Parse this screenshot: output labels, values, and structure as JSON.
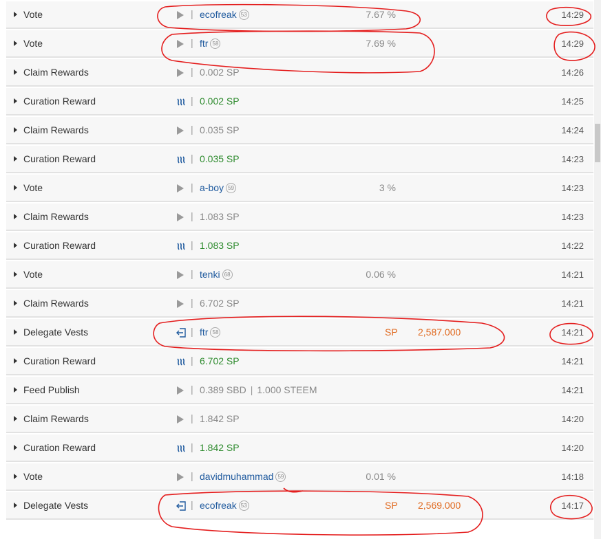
{
  "colors": {
    "user_link": "#1f5a9e",
    "sp_green": "#2e8b2e",
    "sp_orange": "#e0691f",
    "annotation_red": "#e41e1e"
  },
  "rows": [
    {
      "op": "Vote",
      "icon": "play-icon",
      "user": "ecofreak",
      "rep": "53",
      "percent": "7.67 %",
      "time": "14:29"
    },
    {
      "op": "Vote",
      "icon": "play-icon",
      "user": "ftr",
      "rep": "58",
      "percent": "7.69 %",
      "time": "14:29"
    },
    {
      "op": "Claim Rewards",
      "icon": "play-icon",
      "amount": "0.002 SP",
      "time": "14:26"
    },
    {
      "op": "Curation Reward",
      "icon": "steem-icon",
      "amount": "0.002 SP",
      "time": "14:25"
    },
    {
      "op": "Claim Rewards",
      "icon": "play-icon",
      "amount": "0.035 SP",
      "time": "14:24"
    },
    {
      "op": "Curation Reward",
      "icon": "steem-icon",
      "amount": "0.035 SP",
      "time": "14:23"
    },
    {
      "op": "Vote",
      "icon": "play-icon",
      "user": "a-boy",
      "rep": "59",
      "percent": "3 %",
      "time": "14:23"
    },
    {
      "op": "Claim Rewards",
      "icon": "play-icon",
      "amount": "1.083 SP",
      "time": "14:23"
    },
    {
      "op": "Curation Reward",
      "icon": "steem-icon",
      "amount": "1.083 SP",
      "time": "14:22"
    },
    {
      "op": "Vote",
      "icon": "play-icon",
      "user": "tenki",
      "rep": "68",
      "percent": "0.06 %",
      "time": "14:21"
    },
    {
      "op": "Claim Rewards",
      "icon": "play-icon",
      "amount": "6.702 SP",
      "time": "14:21"
    },
    {
      "op": "Delegate Vests",
      "icon": "delegate-icon",
      "user": "ftr",
      "rep": "58",
      "sp_label": "SP",
      "sp_amount": "2,587.000",
      "time": "14:21"
    },
    {
      "op": "Curation Reward",
      "icon": "steem-icon",
      "amount": "6.702 SP",
      "time": "14:21"
    },
    {
      "op": "Feed Publish",
      "icon": "play-icon",
      "sbd": "0.389 SBD",
      "steem": "1.000 STEEM",
      "time": "14:21"
    },
    {
      "op": "Claim Rewards",
      "icon": "play-icon",
      "amount": "1.842 SP",
      "time": "14:20"
    },
    {
      "op": "Curation Reward",
      "icon": "steem-icon",
      "amount": "1.842 SP",
      "time": "14:20"
    },
    {
      "op": "Vote",
      "icon": "play-icon",
      "user": "davidmuhammad",
      "rep": "59",
      "percent": "0.01 %",
      "time": "14:18"
    },
    {
      "op": "Delegate Vests",
      "icon": "delegate-icon",
      "user": "ecofreak",
      "rep": "53",
      "sp_label": "SP",
      "sp_amount": "2,569.000",
      "time": "14:17"
    }
  ]
}
